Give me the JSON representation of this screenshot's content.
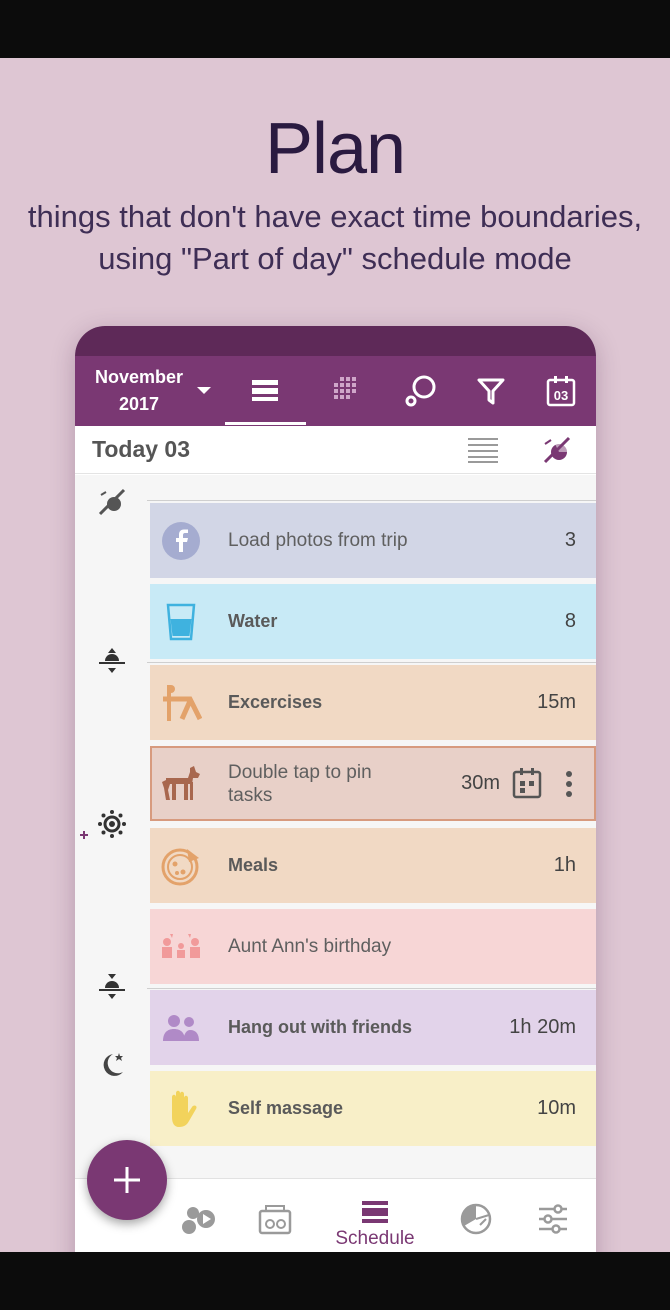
{
  "hero": {
    "title": "Plan",
    "subtitle_line1": "things that don't have exact time boundaries,",
    "subtitle_line2": "using \"Part of day\" schedule mode"
  },
  "toolbar": {
    "month": "November",
    "year": "2017",
    "calendar_day": "03",
    "icons": [
      "list-view-icon",
      "grid-view-icon",
      "search-icon",
      "filter-icon",
      "calendar-icon"
    ]
  },
  "datebar": {
    "label": "Today  03"
  },
  "tasks": [
    {
      "label": "Load photos from trip",
      "value": "3",
      "icon": "facebook-icon",
      "color": "#d2d6e6"
    },
    {
      "label": "Water",
      "value": "8",
      "icon": "water-glass-icon",
      "color": "#c8eaf6"
    },
    {
      "label": "Excercises",
      "value": "15m",
      "icon": "exercise-icon",
      "color": "#f1d9c4"
    },
    {
      "label": "Double tap to pin",
      "label2": "tasks",
      "value": "30m",
      "icon": "dog-icon",
      "color": "#e8d0c8"
    },
    {
      "label": "Meals",
      "value": "1h",
      "icon": "pizza-icon",
      "color": "#f1d9c4"
    },
    {
      "label": "Aunt Ann's birthday",
      "value": "",
      "icon": "family-icon",
      "color": "#f7d6d6"
    },
    {
      "label": "Hang out with friends",
      "value": "1h 20m",
      "icon": "friends-icon",
      "color": "#e2d3ea"
    },
    {
      "label": "Self massage",
      "value": "10m",
      "icon": "hand-icon",
      "color": "#f8efc8"
    }
  ],
  "bottom_nav": {
    "schedule_label": "Schedule"
  },
  "colors": {
    "accent": "#7a3873",
    "status": "#5e2958",
    "poster_bg": "#dec6d3"
  }
}
